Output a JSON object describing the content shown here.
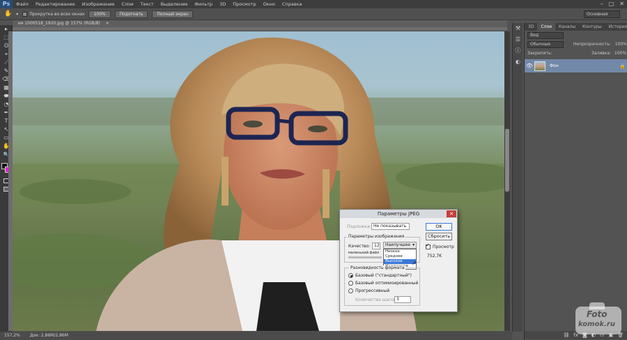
{
  "app": {
    "logo": "Ps"
  },
  "menubar": {
    "items": [
      "Файл",
      "Редактирование",
      "Изображение",
      "Слои",
      "Текст",
      "Выделение",
      "Фильтр",
      "3D",
      "Просмотр",
      "Окно",
      "Справка"
    ]
  },
  "window_controls": [
    "–",
    "□",
    "✕"
  ],
  "options": {
    "scroll_all_label": "Прокрутка во всех окнах",
    "zoom_100": "100%",
    "fit": "Подогнать",
    "fullscreen": "Полный экран",
    "workspace": "Основная"
  },
  "document": {
    "tab_title": "  ия 1000518_1920.jpg @ 157% (RGB/8)",
    "tab_close": "×",
    "status_zoom": "157,2%",
    "status_doc": "Док: 2,86M/2,86M"
  },
  "tools": [
    "▸",
    "⬚",
    "ʘ",
    "⌖",
    "⟋",
    "✎",
    "⌫",
    "▦",
    "⬬",
    "◔",
    "✒",
    "T",
    "↖",
    "▭",
    "✋",
    "🔍"
  ],
  "panels": {
    "tabs": [
      "3D",
      "Слои",
      "Каналы",
      "Контуры",
      "История"
    ],
    "active_tab": "Слои",
    "kind_filter": "Вид",
    "blend_mode": "Обычные",
    "opacity_label": "Непрозрачность:",
    "opacity_value": "100%",
    "lock_label": "Закрепить:",
    "fill_label": "Заливка:",
    "fill_value": "100%",
    "layer_name": "Фон"
  },
  "dialog": {
    "title": "Параметры JPEG",
    "close": "✕",
    "ok": "OK",
    "reset": "Сбросить",
    "matte_label": "Подложка:",
    "matte_value": "Не показывать",
    "image_options_label": "Параметры изображения",
    "quality_label": "Качество:",
    "quality_value": "12",
    "quality_selected": "Наилучшее",
    "quality_options": [
      "Низкое",
      "Среднее",
      "Высокое",
      "Наилучшее"
    ],
    "quality_highlighted": "Высокое",
    "small_file_label": "маленький файл",
    "preview_label": "Просмотр",
    "preview_checked": true,
    "file_size": "752,7K",
    "format_options_label": "Разновидность формата",
    "format_baseline": "Базовый (\"стандартный\")",
    "format_optimized": "Базовый оптимизированный",
    "format_progressive": "Прогрессивный",
    "scans_label": "Количество шагов:",
    "scans_value": "3"
  },
  "watermark": {
    "line1": "Foto",
    "line2": "komok.ru"
  }
}
